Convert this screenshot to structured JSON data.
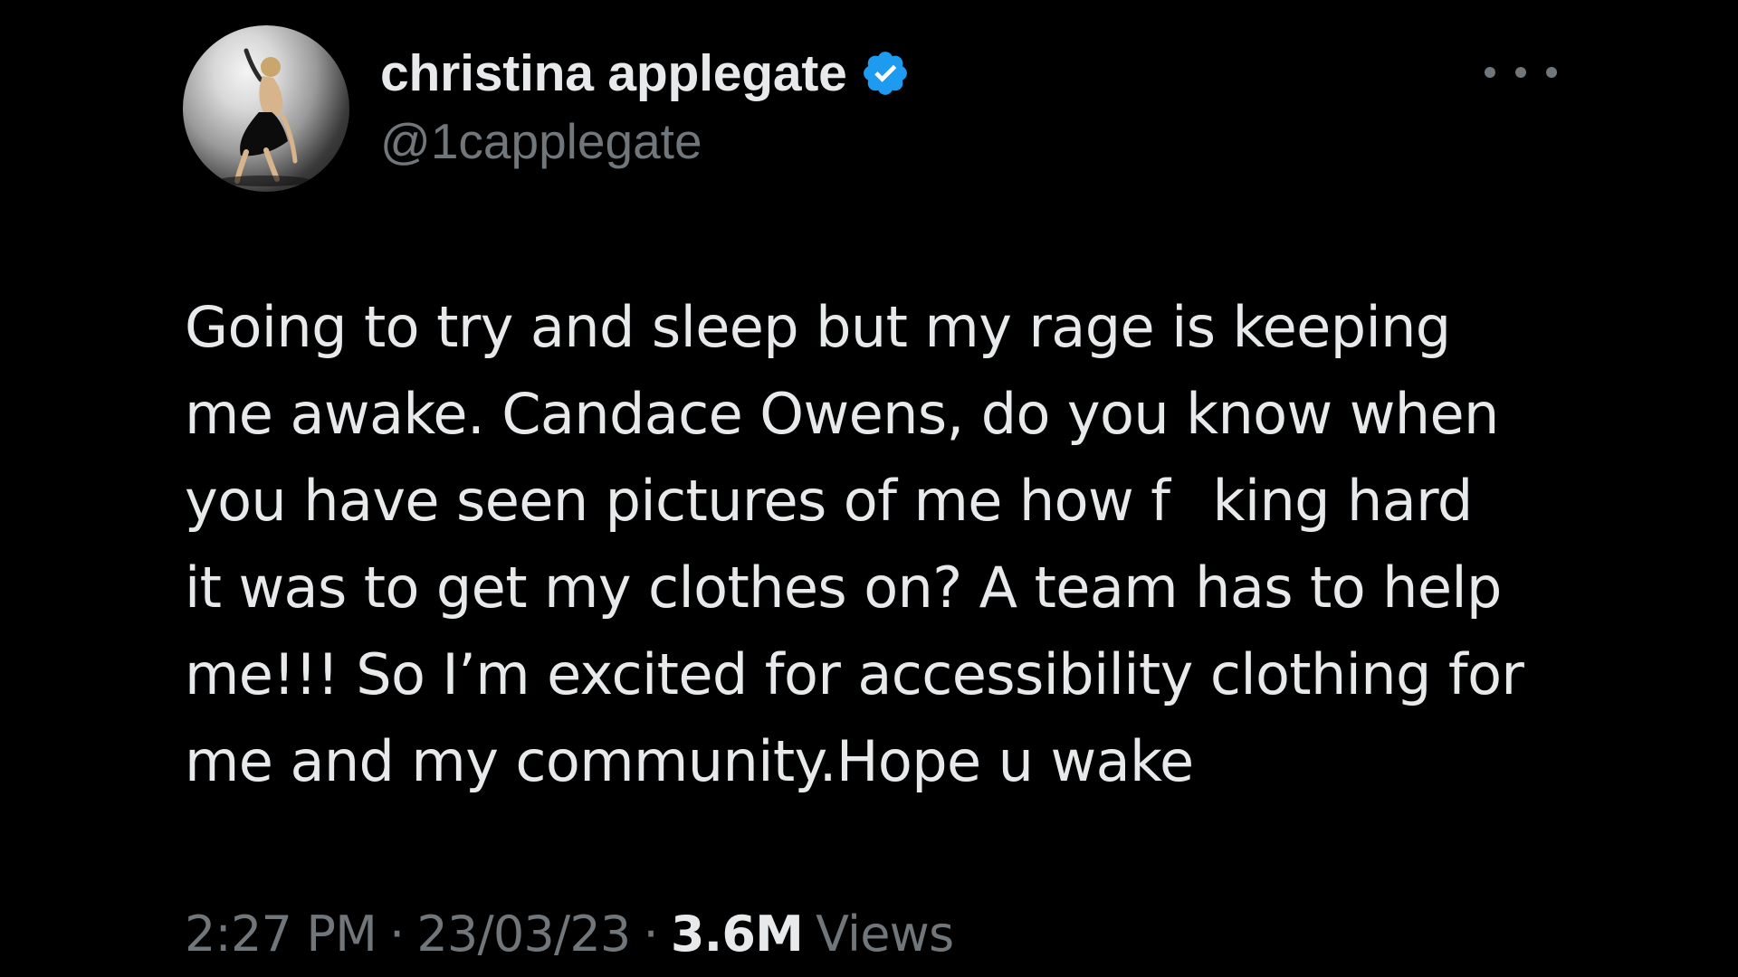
{
  "user": {
    "display_name": "christina applegate",
    "handle": "@1capplegate",
    "verified": true,
    "avatar_icon": "avatar-photo-icon",
    "verified_icon": "verified-badge-icon"
  },
  "menu": {
    "more_icon": "more-options-icon"
  },
  "tweet": {
    "text": "Going to try and sleep but my rage is keeping\nme awake. Candace Owens, do you know when\nyou have seen pictures of me how f    king hard\nit was to get my clothes on? A team has to help\nme!!! So I’m excited for accessibility clothing for\nme and my community.Hope u wake"
  },
  "meta": {
    "time": "2:27 PM",
    "separator": "·",
    "date": "23/03/23",
    "views_count": "3.6M",
    "views_label": "Views"
  },
  "colors": {
    "background": "#000000",
    "primary_text": "#e7e9ea",
    "secondary_text": "#71767b",
    "verified_blue": "#1d9bf0"
  }
}
